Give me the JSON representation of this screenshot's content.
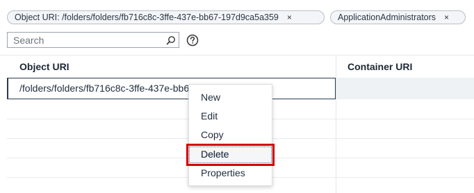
{
  "filters": {
    "chips": [
      {
        "label": "Object URI: /folders/folders/fb716c8c-3ffe-437e-bb67-197d9ca5a359",
        "close": "×"
      },
      {
        "label": "ApplicationAdministrators",
        "close": "×"
      }
    ]
  },
  "search": {
    "placeholder": "Search"
  },
  "table": {
    "columns": [
      "Object URI",
      "Container URI"
    ],
    "selected_row": {
      "object_uri": "/folders/folders/fb716c8c-3ffe-437e-bb67-197d9ca5a359/**"
    }
  },
  "context_menu": {
    "items": [
      "New",
      "Edit",
      "Copy",
      "Delete",
      "Properties"
    ],
    "highlighted": "Delete"
  },
  "colors": {
    "highlight_border": "#d40000",
    "selected_row_border": "#2a3a4d"
  },
  "icons": {
    "search": "search-icon",
    "help": "help-icon",
    "chip_close": "close-icon"
  }
}
